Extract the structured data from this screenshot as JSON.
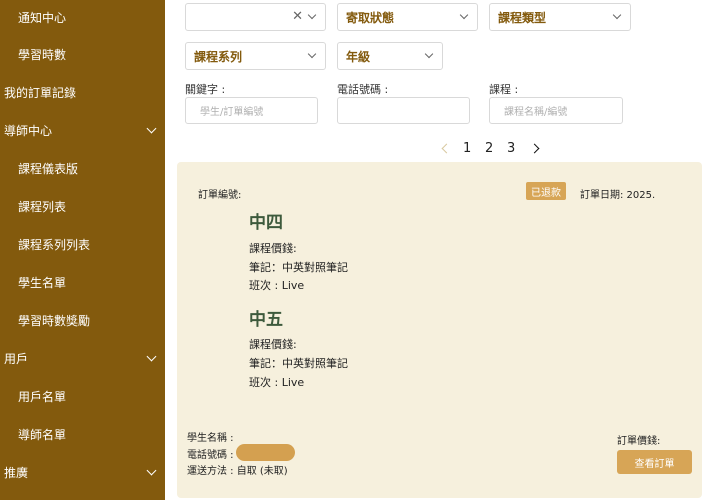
{
  "sidebar": {
    "items": [
      {
        "label": "通知中心"
      },
      {
        "label": "學習時數"
      },
      {
        "label": "我的訂單記錄"
      },
      {
        "label": "導師中心"
      },
      {
        "label": "課程儀表版"
      },
      {
        "label": "課程列表"
      },
      {
        "label": "課程系列列表"
      },
      {
        "label": "學生名單"
      },
      {
        "label": "學習時數獎勵"
      },
      {
        "label": "用戶"
      },
      {
        "label": "用戶名單"
      },
      {
        "label": "導師名單"
      },
      {
        "label": "推廣"
      }
    ]
  },
  "filters": {
    "first_select_value": "",
    "shipping_status": "寄取狀態",
    "course_type": "課程類型",
    "course_series": "課程系列",
    "grade": "年級",
    "keyword_label": "關鍵字 :",
    "keyword_placeholder": "學生/訂單編號",
    "phone_label": "電話號碼 :",
    "phone_placeholder": "",
    "course_label": "課程 :",
    "course_placeholder": "課程名稱/編號"
  },
  "pagination": {
    "pages": [
      "1",
      "2",
      "3"
    ]
  },
  "order": {
    "order_no_label": "訂單編號:",
    "status_badge": "已退款",
    "order_date": "訂單日期: 2025.",
    "items": [
      {
        "grade": "中四",
        "price": "課程價錢:",
        "note": "筆記：中英對照筆記",
        "class": "班次 : Live"
      },
      {
        "grade": "中五",
        "price": "課程價錢:",
        "note": "筆記：中英對照筆記",
        "class": "班次 : Live"
      }
    ],
    "student_name": "學生名稱 :",
    "phone": "電話號碼 :",
    "delivery": "運送方法 : 自取 (未取)",
    "order_price": "訂單價錢:",
    "view_button": "查看訂單"
  },
  "colors": {
    "sidebar_bg": "#835a0d",
    "accent": "#d7a556",
    "card_bg": "#f6f0dd",
    "grade_text": "#3d5a3c"
  }
}
